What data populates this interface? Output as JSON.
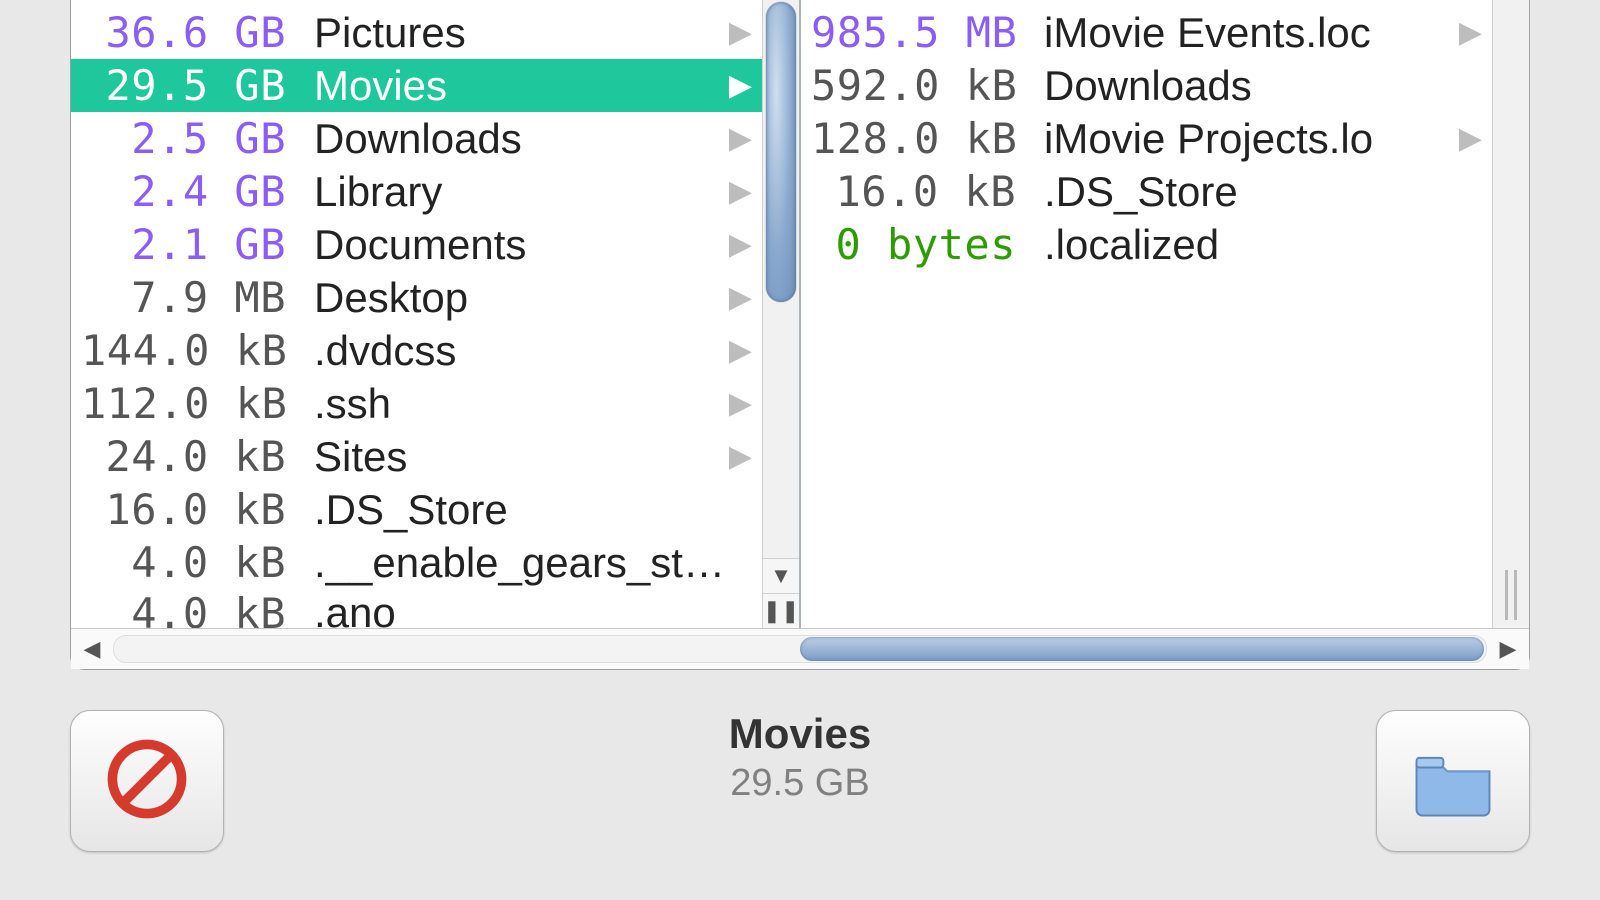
{
  "columns": [
    {
      "name": "home-column",
      "items": [
        {
          "size": "36.6 GB",
          "size_class": "purple",
          "name": "Pictures",
          "has_children": true,
          "selected": false
        },
        {
          "size": "29.5 GB",
          "size_class": "purple",
          "name": "Movies",
          "has_children": true,
          "selected": true
        },
        {
          "size": "2.5 GB",
          "size_class": "purple",
          "name": "Downloads",
          "has_children": true,
          "selected": false
        },
        {
          "size": "2.4 GB",
          "size_class": "purple",
          "name": "Library",
          "has_children": true,
          "selected": false
        },
        {
          "size": "2.1 GB",
          "size_class": "purple",
          "name": "Documents",
          "has_children": true,
          "selected": false
        },
        {
          "size": "7.9 MB",
          "size_class": "black",
          "name": "Desktop",
          "has_children": true,
          "selected": false
        },
        {
          "size": "144.0 kB",
          "size_class": "black",
          "name": ".dvdcss",
          "has_children": true,
          "selected": false
        },
        {
          "size": "112.0 kB",
          "size_class": "black",
          "name": ".ssh",
          "has_children": true,
          "selected": false
        },
        {
          "size": "24.0 kB",
          "size_class": "black",
          "name": "Sites",
          "has_children": true,
          "selected": false
        },
        {
          "size": "16.0 kB",
          "size_class": "black",
          "name": ".DS_Store",
          "has_children": false,
          "selected": false
        },
        {
          "size": "4.0 kB",
          "size_class": "black",
          "name": ".__enable_gears_st…",
          "has_children": false,
          "selected": false
        },
        {
          "size": "4.0 kB",
          "size_class": "black",
          "name": ".ano",
          "has_children": false,
          "selected": false,
          "cutoff": true
        }
      ]
    },
    {
      "name": "movies-column",
      "items": [
        {
          "size": "985.5 MB",
          "size_class": "purple",
          "name": "iMovie Events.loc",
          "has_children": true,
          "selected": false
        },
        {
          "size": "592.0 kB",
          "size_class": "black",
          "name": "Downloads",
          "has_children": false,
          "selected": false
        },
        {
          "size": "128.0 kB",
          "size_class": "black",
          "name": "iMovie Projects.lo",
          "has_children": true,
          "selected": false
        },
        {
          "size": "16.0 kB",
          "size_class": "black",
          "name": ".DS_Store",
          "has_children": false,
          "selected": false
        },
        {
          "size": "0 bytes",
          "size_class": "green",
          "name": ".localized",
          "has_children": false,
          "selected": false
        }
      ]
    }
  ],
  "selection": {
    "name": "Movies",
    "size": "29.5 GB"
  },
  "labels": {
    "scroll_down": "▼",
    "scroll_drag": "❚❚",
    "scroll_left": "◀",
    "scroll_right": "▶"
  }
}
